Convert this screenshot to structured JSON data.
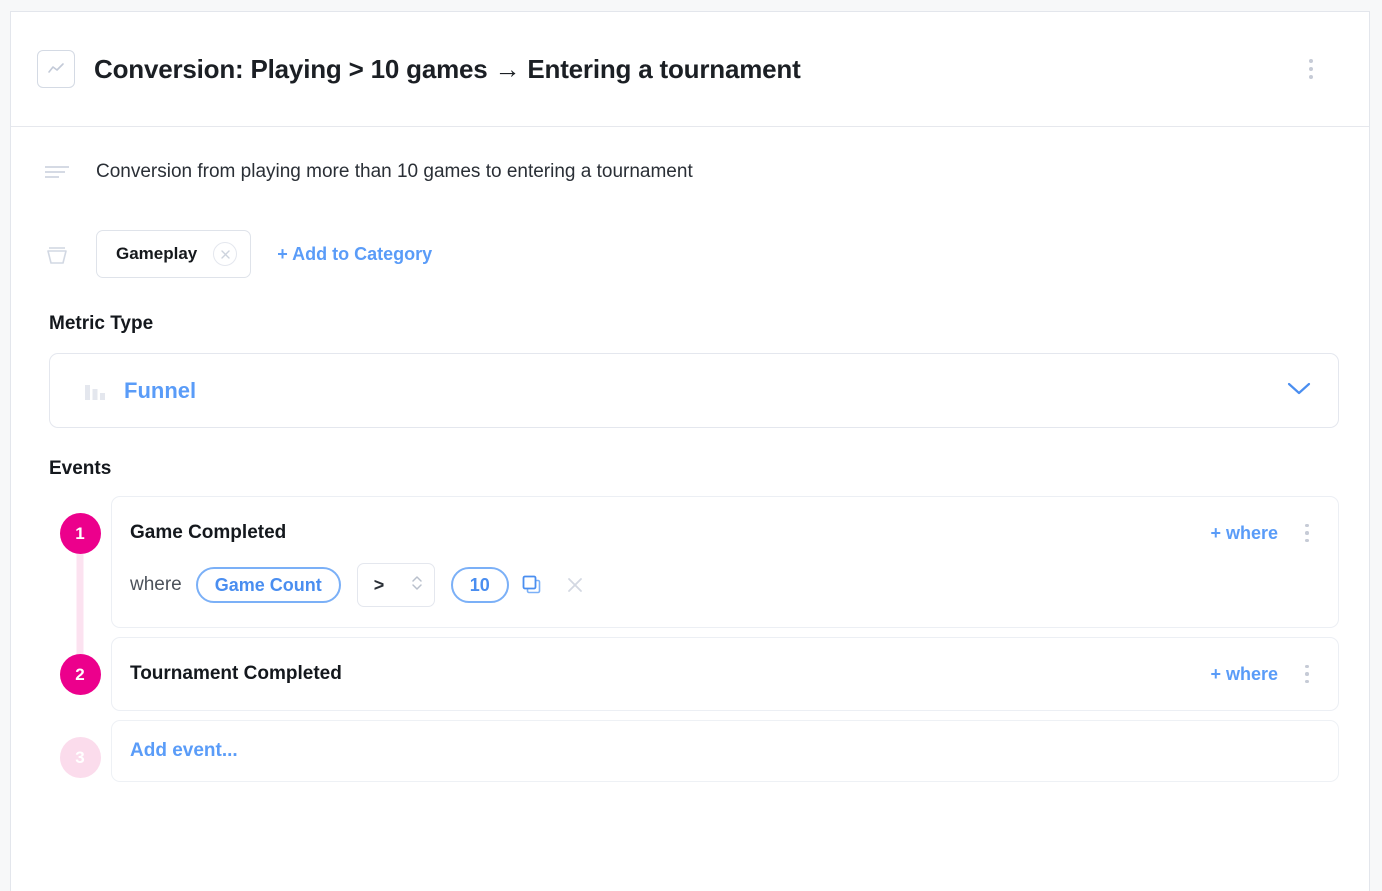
{
  "header": {
    "title": "Conversion: Playing > 10 games → Entering a tournament",
    "icon": "line-chart-icon",
    "menu_icon": "kebab-menu-icon"
  },
  "description": {
    "icon": "text-lines-icon",
    "text": "Conversion from playing more than 10 games to entering a tournament"
  },
  "category": {
    "icon": "basket-icon",
    "chip_label": "Gameplay",
    "chip_remove_icon": "close-circle-icon",
    "add_label": "+ Add to Category"
  },
  "metric_type": {
    "section_label": "Metric Type",
    "selected": "Funnel",
    "icon": "bar-chart-icon",
    "chevron_icon": "chevron-down-icon"
  },
  "events": {
    "section_label": "Events",
    "add_where_label": "+ where",
    "where_label": "where",
    "add_event_label": "Add event...",
    "items": [
      {
        "number": "1",
        "name": "Game Completed",
        "filter": {
          "property": "Game Count",
          "operator": ">",
          "value": "10",
          "duplicate_icon": "duplicate-icon",
          "remove_icon": "close-icon"
        }
      },
      {
        "number": "2",
        "name": "Tournament Completed",
        "filter": null
      }
    ],
    "placeholder_number": "3"
  },
  "colors": {
    "accent_pink": "#ec008c",
    "accent_pink_muted": "#fbdcec",
    "link_blue": "#5a9cf8",
    "pill_blue": "#4a8ef0",
    "border": "#e4e7ee"
  }
}
